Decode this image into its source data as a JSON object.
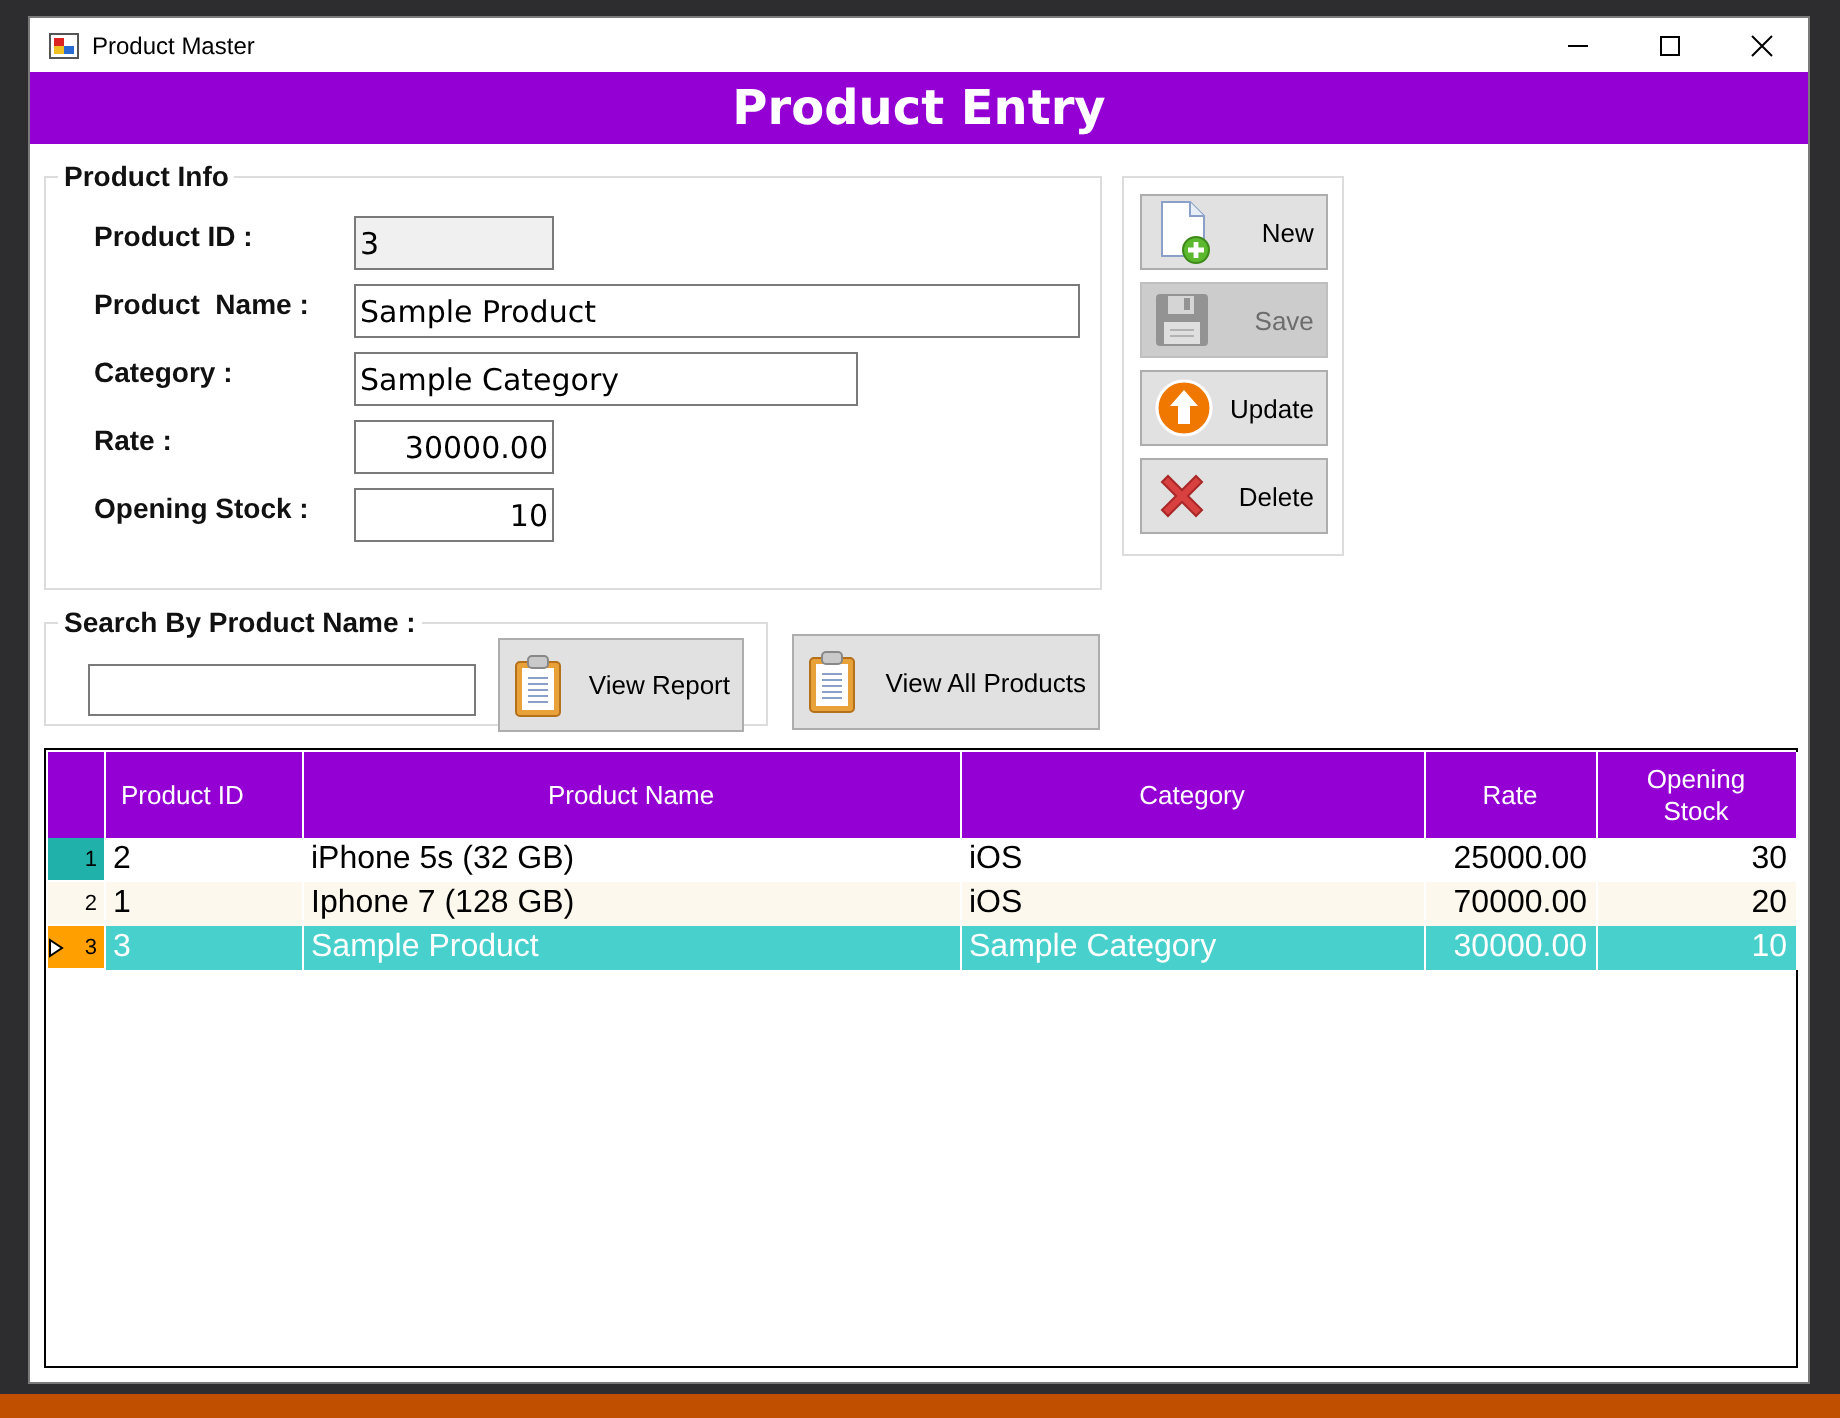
{
  "window": {
    "title": "Product Master"
  },
  "header": {
    "title": "Product Entry"
  },
  "product_info": {
    "legend": "Product Info",
    "fields": [
      {
        "label": "Product ID :",
        "value": "3",
        "kind": "text",
        "readonly": true
      },
      {
        "label": "Product  Name :",
        "value": "Sample Product",
        "kind": "text",
        "readonly": false
      },
      {
        "label": "Category :",
        "value": "Sample Category",
        "kind": "text",
        "readonly": false
      },
      {
        "label": "Rate :",
        "value": "30000.00",
        "kind": "number",
        "readonly": false
      },
      {
        "label": "Opening Stock :",
        "value": "10",
        "kind": "number",
        "readonly": false
      }
    ]
  },
  "actions": [
    {
      "label": "New",
      "kind": "new",
      "disabled": false
    },
    {
      "label": "Save",
      "kind": "save",
      "disabled": true
    },
    {
      "label": "Update",
      "kind": "update",
      "disabled": false
    },
    {
      "label": "Delete",
      "kind": "delete",
      "disabled": false
    }
  ],
  "search": {
    "legend": "Search By Product Name :",
    "report_button": "View Report"
  },
  "view_all_button": "View All Products",
  "table": {
    "columns": [
      "Product ID",
      "Product Name",
      "Category",
      "Rate",
      "Opening Stock"
    ],
    "rows": [
      {
        "number": "1",
        "selected": false,
        "cells": [
          "2",
          "iPhone 5s (32 GB)",
          "iOS",
          "25000.00",
          "30"
        ]
      },
      {
        "number": "2",
        "selected": false,
        "cells": [
          "1",
          "Iphone 7 (128 GB)",
          "iOS",
          "70000.00",
          "20"
        ]
      },
      {
        "number": "3",
        "selected": true,
        "cells": [
          "3",
          "Sample Product",
          "Sample Category",
          "30000.00",
          "10"
        ]
      }
    ]
  }
}
